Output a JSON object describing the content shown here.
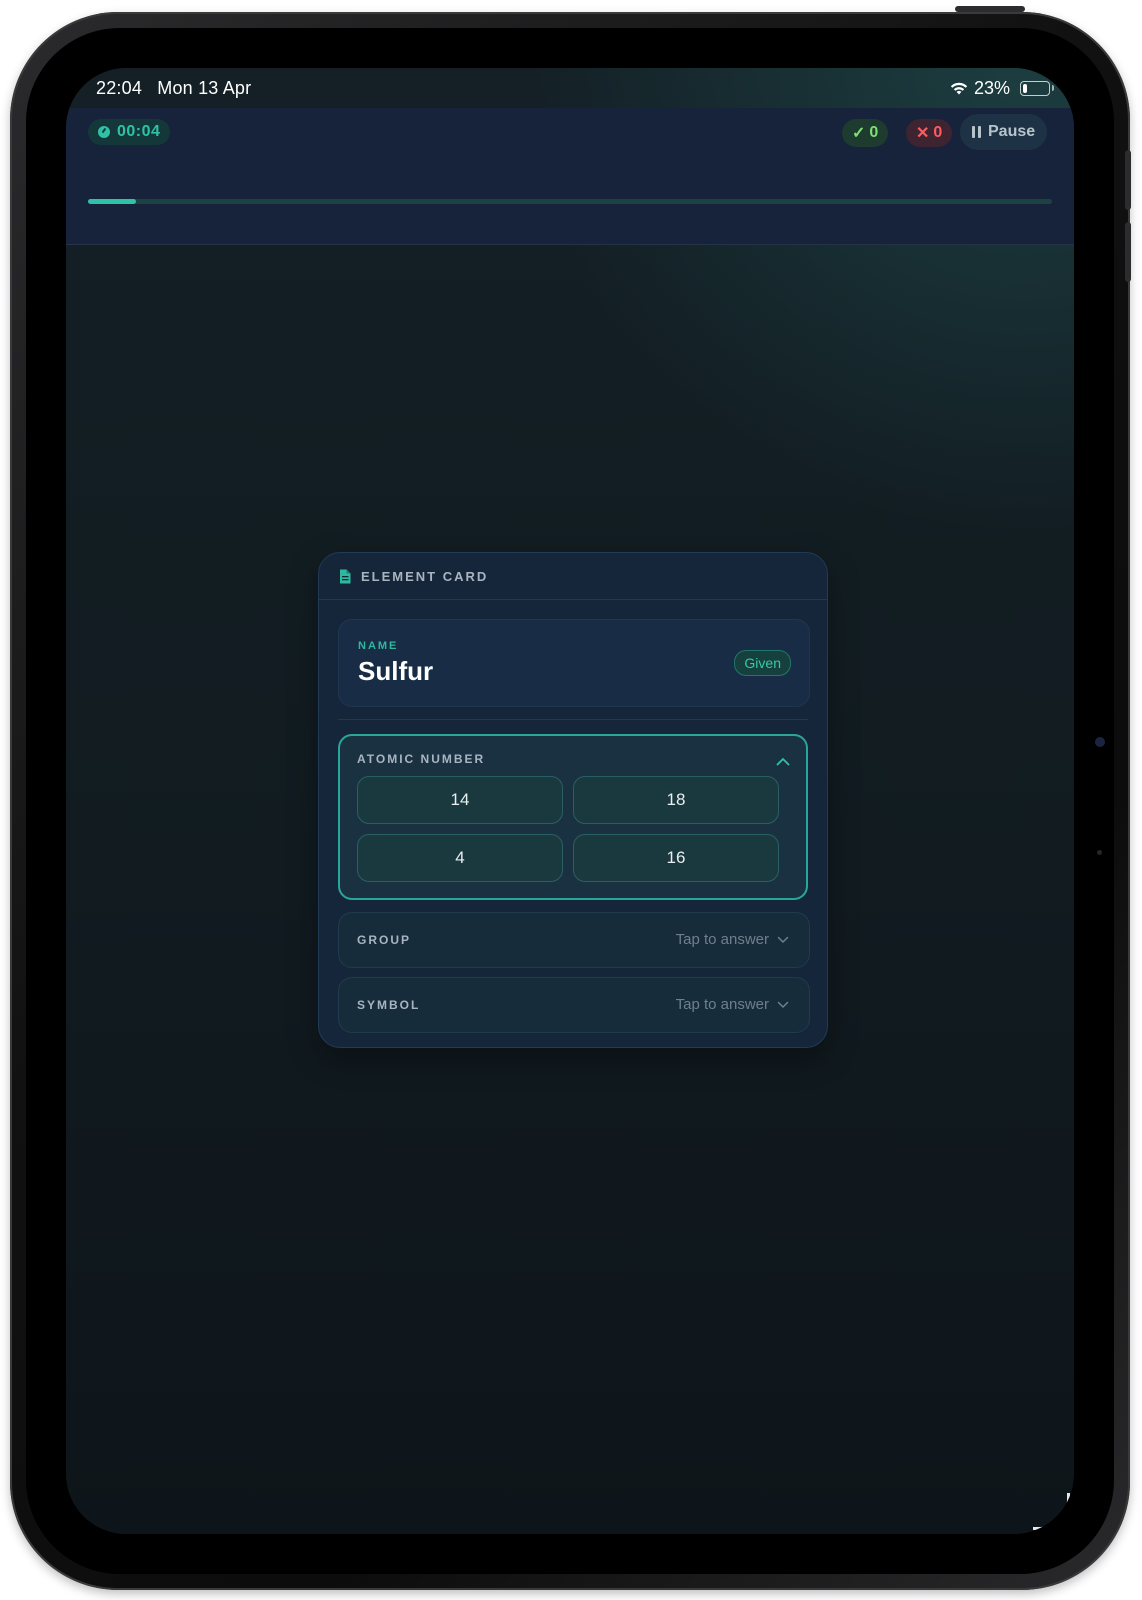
{
  "status_bar": {
    "time": "22:04",
    "date": "Mon 13 Apr",
    "battery": "23%",
    "battery_level": 0.23
  },
  "topbar": {
    "timer": "00:04",
    "correct_count": "0",
    "wrong_count": "0",
    "pause_label": "Pause",
    "progress": 0.05
  },
  "card": {
    "title": "ELEMENT CARD",
    "name_label": "NAME",
    "name_value": "Sulfur",
    "given_badge": "Given",
    "atomic_number": {
      "label": "ATOMIC NUMBER",
      "options": [
        "14",
        "18",
        "4",
        "16"
      ]
    },
    "group": {
      "label": "GROUP",
      "hint": "Tap to answer"
    },
    "symbol": {
      "label": "SYMBOL",
      "hint": "Tap to answer"
    }
  },
  "colors": {
    "accent": "#2fc2a6",
    "correct": "#7fe070",
    "wrong": "#ff5a62"
  }
}
